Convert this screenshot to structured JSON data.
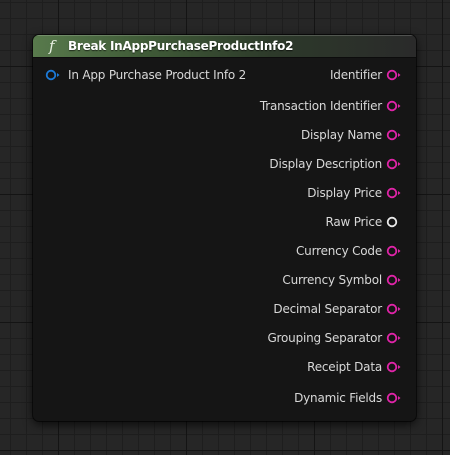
{
  "node": {
    "title": "Break InAppPurchaseProductInfo2",
    "icon": "function-icon",
    "icon_glyph": "f",
    "header_color": "#587a4c"
  },
  "input_pin": {
    "label": "In App Purchase Product Info 2",
    "color": "#1c7ad8"
  },
  "output_pins": [
    {
      "label": "Identifier",
      "color": "#e024a8",
      "type": "string"
    },
    {
      "label": "Transaction Identifier",
      "color": "#e024a8",
      "type": "string"
    },
    {
      "label": "Display Name",
      "color": "#e024a8",
      "type": "string"
    },
    {
      "label": "Display Description",
      "color": "#e024a8",
      "type": "string"
    },
    {
      "label": "Display Price",
      "color": "#e024a8",
      "type": "string"
    },
    {
      "label": "Raw Price",
      "color": "#eaeaea",
      "type": "plain"
    },
    {
      "label": "Currency Code",
      "color": "#e024a8",
      "type": "string"
    },
    {
      "label": "Currency Symbol",
      "color": "#e024a8",
      "type": "string"
    },
    {
      "label": "Decimal Separator",
      "color": "#e024a8",
      "type": "string"
    },
    {
      "label": "Grouping Separator",
      "color": "#e024a8",
      "type": "string"
    },
    {
      "label": "Receipt Data",
      "color": "#e024a8",
      "type": "string"
    },
    {
      "label": "Dynamic Fields",
      "color": "#e024a8",
      "type": "string"
    }
  ]
}
